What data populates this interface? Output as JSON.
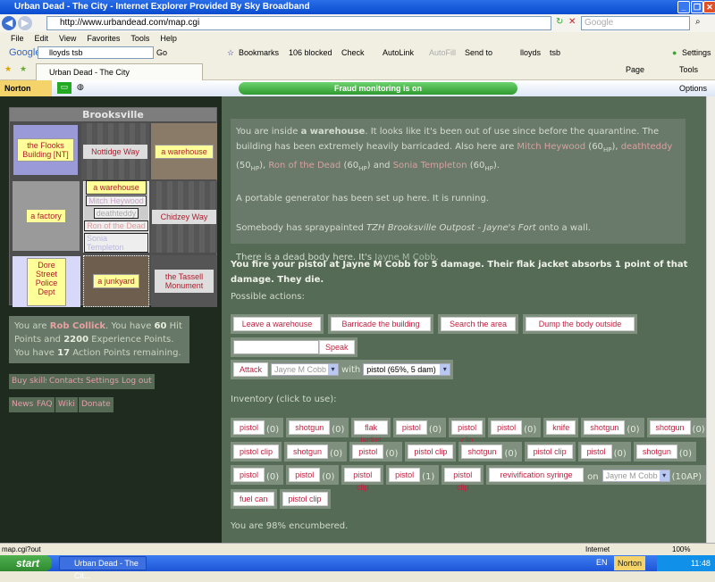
{
  "browser": {
    "title": "Urban Dead - The City - Internet Explorer Provided By Sky Broadband",
    "url": "http://www.urbandead.com/map.cgi",
    "search_placeholder": "Google",
    "menu": [
      "File",
      "Edit",
      "View",
      "Favorites",
      "Tools",
      "Help"
    ],
    "google_logo": "Google",
    "google_query": "lloyds tsb",
    "go": "Go",
    "bookmarks": "Bookmarks",
    "blocked": "106 blocked",
    "check": "Check",
    "autolink": "AutoLink",
    "autofill": "AutoFill",
    "sendto": "Send to",
    "bm1": "lloyds",
    "bm2": "tsb",
    "settings": "Settings",
    "tab": "Urban Dead - The City",
    "page": "Page",
    "tools": "Tools",
    "norton": "Norton",
    "fraud": "Fraud monitoring is on",
    "options": "Options",
    "status": "map.cgi?out",
    "zone": "Internet",
    "zoom": "100%",
    "start": "start",
    "task": "Urban Dead - The Cit...",
    "lang": "EN",
    "tray_norton": "Norton",
    "clock": "11:48"
  },
  "map": {
    "suburb": "Brooksville",
    "cells": {
      "nw": "the Flooks Building [NT]",
      "n": "Nottidge Way",
      "ne": "a warehouse",
      "w": "a factory",
      "c": "a warehouse",
      "e": "Chidzey Way",
      "sw": "Dore Street Police Dept",
      "s": "a junkyard",
      "se": "the Tassell Monument"
    },
    "people": [
      "Mitch Heywood",
      "deathteddy",
      "Ron of the Dead",
      "Sonia Templeton"
    ]
  },
  "player": {
    "pre": "You are ",
    "name": "Rob Collick",
    "mid1": ". You have ",
    "hp": "60",
    "mid2": " Hit Points and ",
    "xp": "2200",
    "mid3": " Experience Points. You have ",
    "ap": "17",
    "end": " Action Points remaining."
  },
  "links": [
    "Buy skills",
    "Contacts",
    "Settings",
    "Log out",
    "News",
    "FAQ",
    "Wiki",
    "Donate"
  ],
  "desc": {
    "p1a": "You are inside ",
    "p1b": "a warehouse",
    "p1c": ". It looks like it's been out of use since before the quarantine. The building has been extremely heavily barricaded. Also here are ",
    "n1": "Mitch Heywood",
    "h1": "(60",
    "n2": "deathteddy",
    "h2": "(50",
    "n3": "Ron of the Dead",
    "h3": "(60",
    "n4": "Sonia Templeton",
    "h4": "(60",
    "hp": "HP",
    "and": " and ",
    "p2": "A portable generator has been set up here. It is running.",
    "p3a": "Somebody has spraypainted ",
    "p3b": "TZH Brooksville Outpost - Jayne's Fort",
    "p3c": " onto a wall.",
    "p4a": "There is a dead body here. It's ",
    "p4b": "Jayne M Cobb",
    "p4c": "."
  },
  "message": "You fire your pistol at Jayne M Cobb for 5 damage. Their flak jacket absorbs 1 point of that damage. They die.",
  "actions": {
    "label": "Possible actions:",
    "buttons": [
      "Leave a warehouse",
      "Barricade the building",
      "Search the area",
      "Dump the body outside"
    ],
    "speak": "Speak",
    "attack": "Attack",
    "target": "Jayne M Cobb",
    "with": "with",
    "weapon": "pistol (65%, 5 dam)"
  },
  "inventory": {
    "label": "Inventory (click to use):",
    "rows": [
      [
        {
          "l": "pistol",
          "c": "(0)"
        },
        {
          "l": "shotgun",
          "c": "(0)"
        },
        {
          "l": "flak jacket"
        },
        {
          "l": "pistol",
          "c": "(0)"
        },
        {
          "l": "pistol clip"
        },
        {
          "l": "pistol",
          "c": "(0)"
        },
        {
          "l": "knife"
        },
        {
          "l": "shotgun",
          "c": "(0)"
        },
        {
          "l": "shotgun",
          "c": "(0)"
        }
      ],
      [
        {
          "l": "pistol clip"
        },
        {
          "l": "shotgun",
          "c": "(0)"
        },
        {
          "l": "pistol",
          "c": "(0)"
        },
        {
          "l": "pistol clip"
        },
        {
          "l": "shotgun",
          "c": "(0)"
        },
        {
          "l": "pistol clip"
        },
        {
          "l": "pistol",
          "c": "(0)"
        },
        {
          "l": "shotgun",
          "c": "(0)"
        }
      ],
      [
        {
          "l": "pistol",
          "c": "(0)"
        },
        {
          "l": "pistol",
          "c": "(0)"
        },
        {
          "l": "pistol clip"
        },
        {
          "l": "pistol",
          "c": "(1)"
        },
        {
          "l": "pistol clip"
        },
        {
          "l": "revivification syringe",
          "on": "on",
          "target": "Jayne M Cobb",
          "c": "(10AP)"
        }
      ],
      [
        {
          "l": "fuel can"
        },
        {
          "l": "pistol clip"
        }
      ]
    ],
    "encumbrance": "You are 98% encumbered."
  }
}
